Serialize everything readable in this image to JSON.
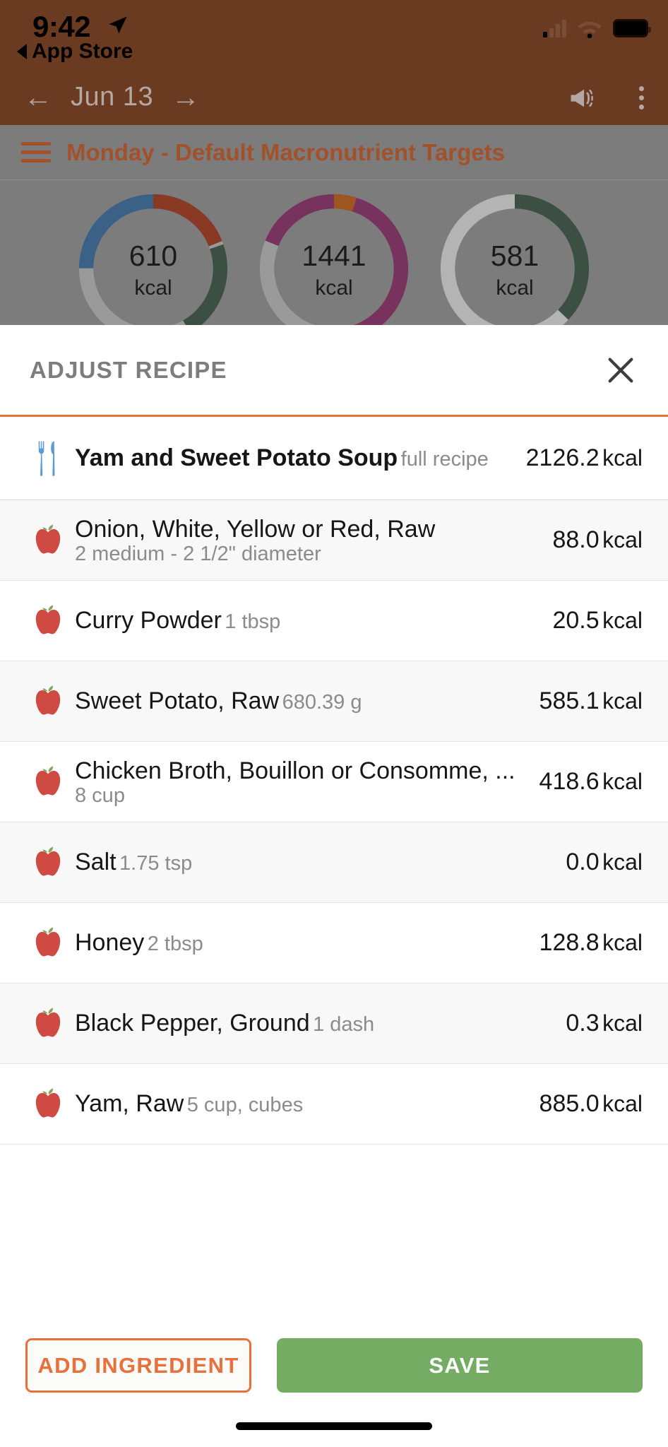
{
  "status_bar": {
    "time": "9:42",
    "back_label": "App Store",
    "location_icon": "location-arrow-icon",
    "signal_icon": "cellular-signal-icon",
    "wifi_icon": "wifi-icon",
    "battery_icon": "battery-icon"
  },
  "nav": {
    "prev_icon": "arrow-left-icon",
    "date": "Jun 13",
    "next_icon": "arrow-right-icon",
    "announce_icon": "megaphone-icon",
    "menu_icon": "kebab-menu-icon"
  },
  "day_bar": {
    "menu_icon": "hamburger-menu-icon",
    "title": "Monday - Default Macronutrient Targets",
    "accent_color": "#a2512b"
  },
  "summary": {
    "donuts": [
      {
        "value": "610",
        "unit": "kcal",
        "segments": [
          {
            "name": "carbs",
            "color": "#3c6186",
            "pct": 44
          },
          {
            "name": "fat",
            "color": "#8a3a24",
            "pct": 19
          },
          {
            "name": "protein",
            "color": "#3b4f43",
            "pct": 22
          }
        ],
        "track_color": "#9a9a9a"
      },
      {
        "value": "1441",
        "unit": "kcal",
        "segments": [
          {
            "name": "carbs",
            "color": "#77335e",
            "pct": 47
          },
          {
            "name": "fat",
            "color": "#9e5520",
            "pct": 5
          },
          {
            "name": "protein",
            "color": "#77335e",
            "pct": 46
          }
        ],
        "track_color": "#9a9a9a"
      },
      {
        "value": "581",
        "unit": "kcal",
        "segments": [
          {
            "name": "remaining",
            "color": "#b4b4b4",
            "pct": 63
          },
          {
            "name": "consumed",
            "color": "#3b4f43",
            "pct": 37
          }
        ],
        "track_color": "#9a9a9a"
      }
    ]
  },
  "sheet": {
    "title": "ADJUST RECIPE",
    "close_icon": "close-icon",
    "divider_color": "#e8703a"
  },
  "recipe": {
    "icon": "fork-knife-icon",
    "name": "Yam and Sweet Potato Soup",
    "serving": "full recipe",
    "calories": "2126.2",
    "unit": "kcal"
  },
  "ingredients": [
    {
      "icon": "apple-icon",
      "name": "Onion, White, Yellow or Red, Raw",
      "serving": "2 medium - 2 1/2\" diameter",
      "calories": "88.0",
      "unit": "kcal"
    },
    {
      "icon": "apple-icon",
      "name": "Curry Powder",
      "serving": "1 tbsp",
      "calories": "20.5",
      "unit": "kcal"
    },
    {
      "icon": "apple-icon",
      "name": "Sweet Potato, Raw",
      "serving": "680.39 g",
      "calories": "585.1",
      "unit": "kcal"
    },
    {
      "icon": "apple-icon",
      "name": "Chicken Broth, Bouillon or Consomme, ...",
      "serving": "8 cup",
      "calories": "418.6",
      "unit": "kcal"
    },
    {
      "icon": "apple-icon",
      "name": "Salt",
      "serving": "1.75 tsp",
      "calories": "0.0",
      "unit": "kcal"
    },
    {
      "icon": "apple-icon",
      "name": "Honey",
      "serving": "2 tbsp",
      "calories": "128.8",
      "unit": "kcal"
    },
    {
      "icon": "apple-icon",
      "name": "Black Pepper, Ground",
      "serving": "1 dash",
      "calories": "0.3",
      "unit": "kcal"
    },
    {
      "icon": "apple-icon",
      "name": "Yam, Raw",
      "serving": "5 cup, cubes",
      "calories": "885.0",
      "unit": "kcal"
    }
  ],
  "footer": {
    "add_label": "ADD INGREDIENT",
    "save_label": "SAVE",
    "add_color": "#e8703a",
    "save_color": "#74ac63"
  }
}
